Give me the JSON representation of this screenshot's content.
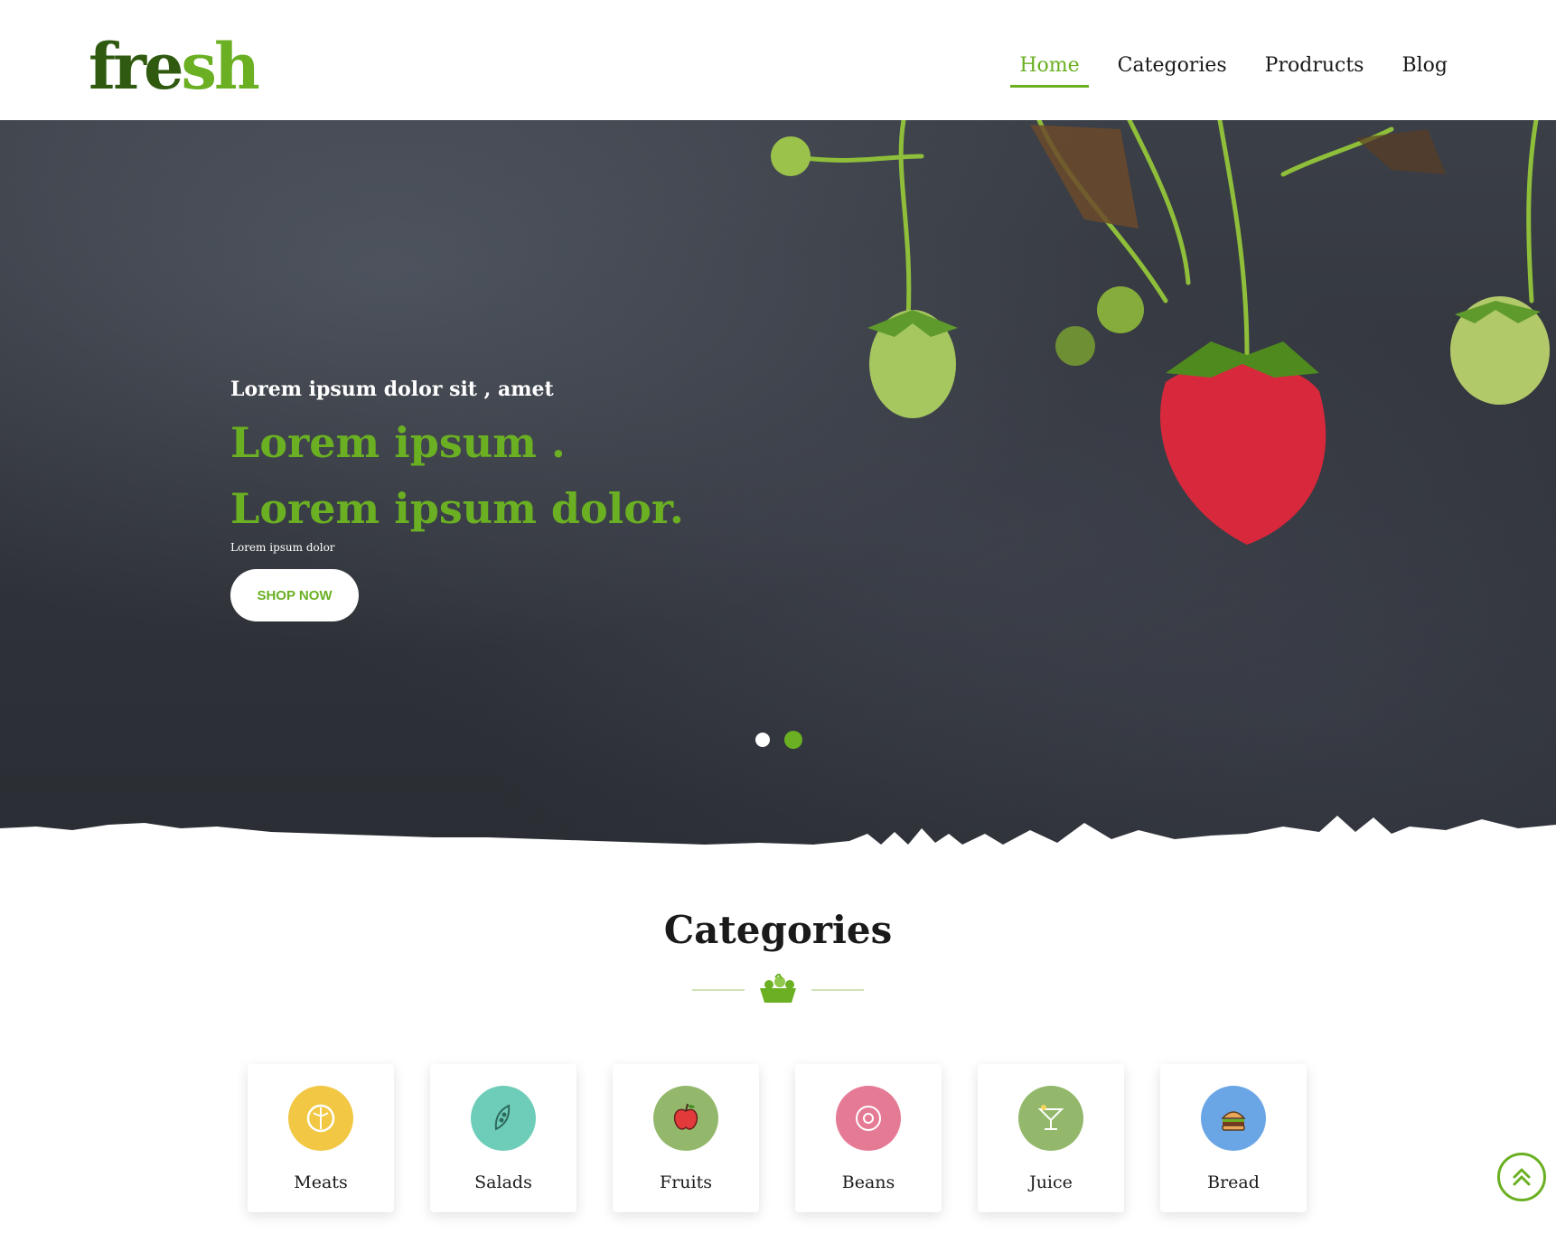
{
  "brand": {
    "logo_part1": "fre",
    "logo_part2": "sh",
    "accent": "#6ab022",
    "dark_green": "#2f5a10"
  },
  "nav": {
    "items": [
      {
        "label": "Home",
        "active": true
      },
      {
        "label": "Categories",
        "active": false
      },
      {
        "label": "Prodructs",
        "active": false
      },
      {
        "label": "Blog",
        "active": false
      }
    ]
  },
  "hero": {
    "subtitle": "Lorem ipsum dolor sit , amet",
    "title_line1": "Lorem ipsum .",
    "title_line2": "Lorem ipsum dolor.",
    "small_text": "Lorem ipsum dolor",
    "button_label": "SHOP NOW",
    "slides_count": 2,
    "active_slide": 2
  },
  "categories": {
    "title": "Categories",
    "items": [
      {
        "label": "Meats",
        "icon": "cabbage-icon",
        "color": "#f2c744"
      },
      {
        "label": "Salads",
        "icon": "pea-pod-icon",
        "color": "#6dcdb8"
      },
      {
        "label": "Fruits",
        "icon": "apple-icon",
        "color": "#93b86b"
      },
      {
        "label": "Beans",
        "icon": "bean-icon",
        "color": "#e57a95"
      },
      {
        "label": "Juice",
        "icon": "cocktail-icon",
        "color": "#93b86b"
      },
      {
        "label": "Bread",
        "icon": "burger-icon",
        "color": "#6aa6e6"
      }
    ]
  }
}
